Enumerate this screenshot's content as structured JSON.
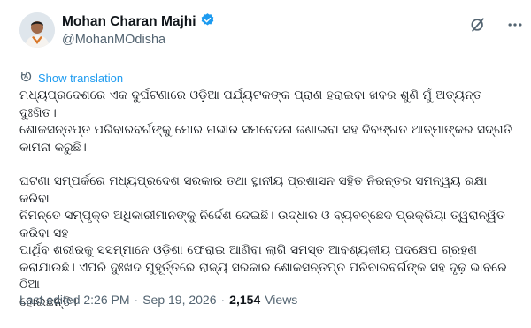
{
  "author": {
    "name": "Mohan Charan Majhi",
    "handle": "@MohanMOdisha",
    "verified_color": "#1d9bf0"
  },
  "actions": {
    "grok_icon": "grok-icon",
    "more_icon": "more-icon"
  },
  "translate": {
    "label": "Show translation"
  },
  "post": {
    "paragraph1": "ମଧ୍ୟପ୍ରଦେଶରେ ଏକ ଦୁର୍ଘଟଣାରେ ଓଡ଼ିଆ ପର୍ଯ୍ୟଟକଙ୍କ ପ୍ରାଣ ହରାଇବା ଖବର ଶୁଣି ମୁଁ ଅତ୍ୟନ୍ତ ଦୁଃଖିତ।\nଶୋକସନ୍ତପ୍ତ ପରିବାରବର୍ଗଙ୍କୁ ମୋର ଗଭୀର ସମବେଦନା ଜଣାଇବା ସହ ଦିବଙ୍ଗତ ଆତ୍ମାଙ୍କର ସଦ୍‌ଗତି\nକାମନା କରୁଛି।",
    "paragraph2": "ଘଟଣା ସମ୍ପର୍କରେ ମଧ୍ୟପ୍ରଦେଶ ସରକାର ତଥା ସ୍ଥାନୀୟ ପ୍ରଶାସନ ସହିତ ନିରନ୍ତର ସମନ୍ୱୟ ରକ୍ଷା କରିବା\nନିମନ୍ତେ ସମ୍ପୃକ୍ତ ଅଧିକାରୀମାନଙ୍କୁ ନିର୍ଦ୍ଦେଶ ଦେଇଛି। ଉଦ୍ଧାର ଓ ବ୍ୟବଚ୍ଛେଦ ପ୍ରକ୍ରିୟା ତ୍ୱରାନ୍ୱିତ କରିବା ସହ\nପାର୍ଥିବ ଶରୀରକୁ ସସମ୍ମାନେ ଓଡ଼ିଶା ଫେରାଇ ଆଣିବା ଲାଗି ସମସ୍ତ ଆବଶ୍ୟକୀୟ ପଦକ୍ଷେପ ଗ୍ରହଣ\nକରାଯାଉଛି। ଏପରି ଦୁଃଖଦ ମୁହୂର୍ତ୍ତରେ ରାଜ୍ୟ ସରକାର ଶୋକସନ୍ତପ୍ତ ପରିବାରବର୍ଗଙ୍କ ସହ ଦୃଢ଼ ଭାବରେ ଠିଆ\nହୋଇଛନ୍ତି।"
  },
  "meta": {
    "edited": "Last edited 2:26 PM",
    "sep1": "·",
    "date": "Sep 19, 2026",
    "sep2": "·",
    "views_count": "2,154",
    "views_label": "Views"
  }
}
